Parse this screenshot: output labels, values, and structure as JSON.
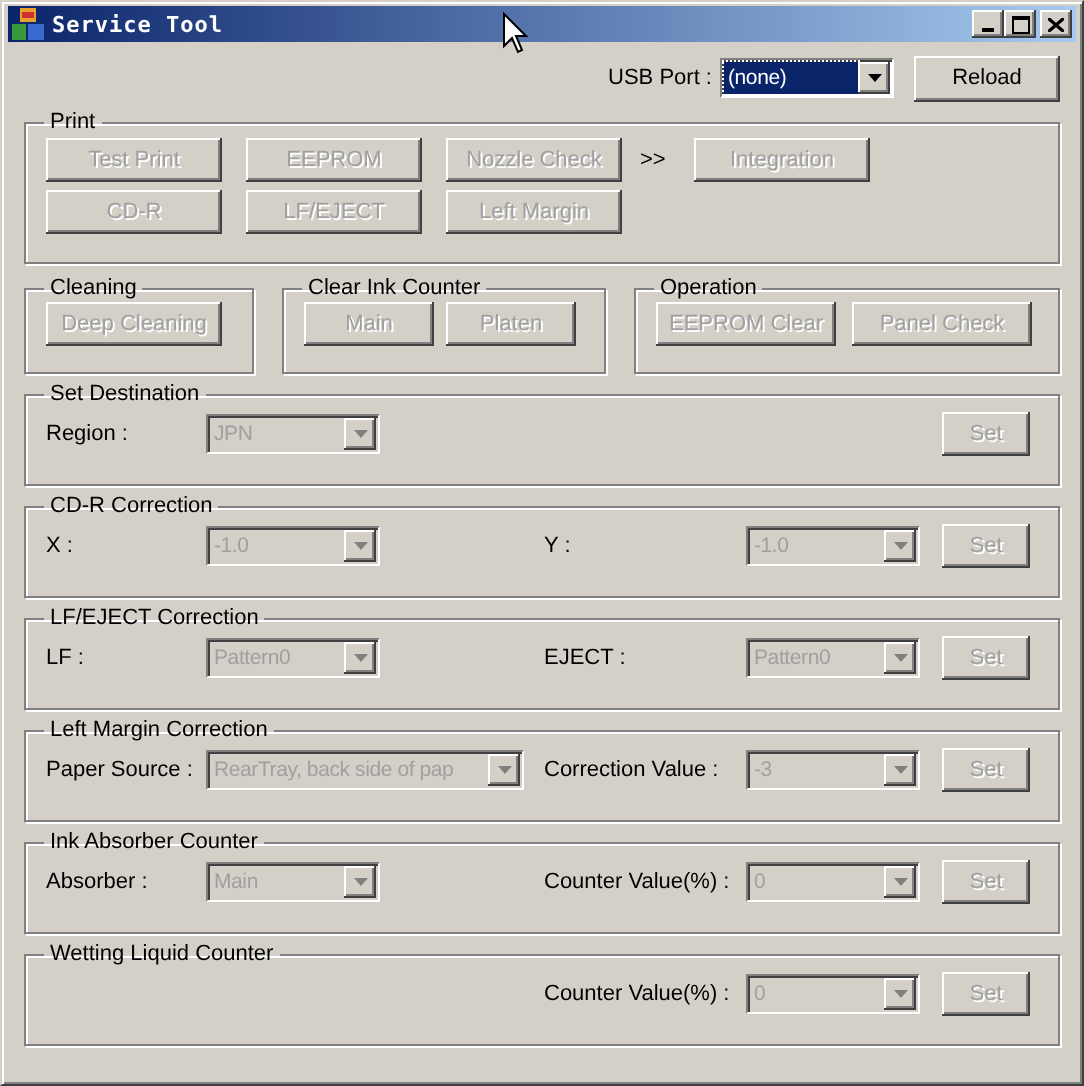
{
  "window": {
    "title": "Service Tool"
  },
  "usb_port": {
    "label": "USB Port :",
    "value": "(none)",
    "focused": true
  },
  "reload_button": {
    "label": "Reload",
    "disabled": false
  },
  "print": {
    "title": "Print",
    "rows": [
      [
        {
          "kind": "button",
          "label": "Test Print",
          "disabled": true
        },
        {
          "kind": "button",
          "label": "EEPROM",
          "disabled": true
        },
        {
          "kind": "button",
          "label": "Nozzle Check",
          "disabled": true
        },
        {
          "kind": "separator",
          "label": ">>"
        },
        {
          "kind": "button",
          "label": "Integration",
          "disabled": true
        }
      ],
      [
        {
          "kind": "button",
          "label": "CD-R",
          "disabled": true
        },
        {
          "kind": "button",
          "label": "LF/EJECT",
          "disabled": true
        },
        {
          "kind": "button",
          "label": "Left Margin",
          "disabled": true
        }
      ]
    ]
  },
  "groups": [
    {
      "title": "Cleaning",
      "buttons": [
        {
          "label": "Deep Cleaning",
          "disabled": true
        }
      ]
    },
    {
      "title": "Clear Ink Counter",
      "buttons": [
        {
          "label": "Main",
          "disabled": true
        },
        {
          "label": "Platen",
          "disabled": true
        }
      ]
    },
    {
      "title": "Operation",
      "buttons": [
        {
          "label": "EEPROM Clear",
          "disabled": true
        },
        {
          "label": "Panel Check",
          "disabled": true
        }
      ]
    }
  ],
  "corrections": [
    {
      "title": "Set Destination",
      "left": {
        "label": "Region :",
        "value": "JPN",
        "kind": "combo",
        "disabled": true
      },
      "set_button": {
        "label": "Set",
        "disabled": true
      }
    },
    {
      "title": "CD-R Correction",
      "left": {
        "label": "X :",
        "value": "-1.0",
        "kind": "combo",
        "disabled": true
      },
      "right": {
        "label": "Y :",
        "value": "-1.0",
        "disabled": true
      },
      "set_button": {
        "label": "Set",
        "disabled": true
      }
    },
    {
      "title": "LF/EJECT Correction",
      "left": {
        "label": "LF :",
        "value": "Pattern0",
        "kind": "combo",
        "disabled": true
      },
      "right": {
        "label": "EJECT :",
        "value": "Pattern0",
        "disabled": true
      },
      "set_button": {
        "label": "Set",
        "disabled": true
      }
    },
    {
      "title": "Left Margin Correction",
      "left": {
        "label": "Paper Source :",
        "value": "RearTray, back side of pap",
        "kind": "wide_combo",
        "disabled": true
      },
      "right": {
        "label": "Correction Value :",
        "value": "-3",
        "disabled": true
      },
      "set_button": {
        "label": "Set",
        "disabled": true
      }
    },
    {
      "title": "Ink Absorber Counter",
      "left": {
        "label": "Absorber :",
        "value": "Main",
        "kind": "combo",
        "disabled": true
      },
      "right": {
        "label": "Counter Value(%) :",
        "value": "0",
        "disabled": true
      },
      "set_button": {
        "label": "Set",
        "disabled": true
      }
    },
    {
      "title": "Wetting Liquid Counter",
      "right": {
        "label": "Counter Value(%) :",
        "value": "0",
        "disabled": true
      },
      "set_button": {
        "label": "Set",
        "disabled": true
      }
    }
  ]
}
